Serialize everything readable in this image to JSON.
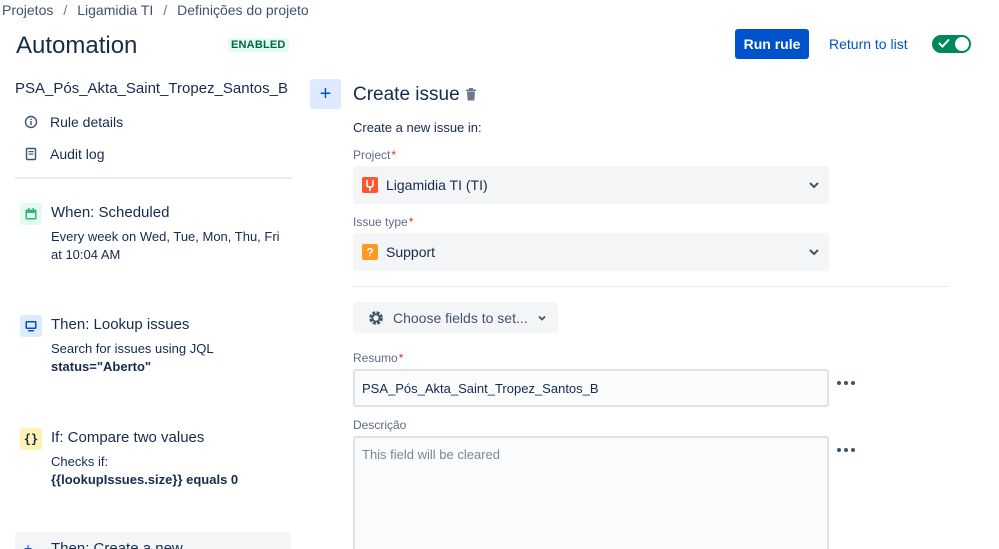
{
  "breadcrumb": [
    "Projetos",
    "Ligamidia TI",
    "Definições do projeto"
  ],
  "header": {
    "title": "Automation",
    "status_badge": "ENABLED",
    "run_label": "Run rule",
    "return_label": "Return to list",
    "toggle_on": true
  },
  "sidebar": {
    "rule_name": "PSA_Pós_Akta_Saint_Tropez_Santos_B",
    "links": [
      {
        "label": "Rule details",
        "icon": "info-icon"
      },
      {
        "label": "Audit log",
        "icon": "document-icon"
      }
    ],
    "steps": [
      {
        "title": "When: Scheduled",
        "line1": "Every week on Wed, Tue, Mon, Thu, Fri",
        "line2": "at 10:04 AM",
        "icon": "calendar-icon",
        "color": "#36b37e"
      },
      {
        "title": "Then: Lookup issues",
        "line1": "Search for issues using JQL",
        "line2": "status=\"Aberto\"",
        "icon": "monitor-icon",
        "color": "#0052cc"
      },
      {
        "title": "If: Compare two values",
        "line1": "Checks if:",
        "line2": "{{lookupIssues.size}} equals 0",
        "icon": "braces-icon",
        "color": "#ffab00"
      }
    ],
    "last_step_title": "Then: Create a new"
  },
  "panel": {
    "title": "Create issue",
    "subtitle": "Create a new issue in:",
    "project_label": "Project",
    "project_value": "Ligamidia TI (TI)",
    "issue_type_label": "Issue type",
    "issue_type_value": "Support",
    "choose_fields_label": "Choose fields to set...",
    "summary_label": "Resumo",
    "summary_value": "PSA_Pós_Akta_Saint_Tropez_Santos_B",
    "description_label": "Descrição",
    "description_placeholder": "This field will be cleared",
    "required_mark": "*"
  },
  "colors": {
    "primary": "#0052cc",
    "success": "#00875a",
    "project_icon": "#ff5630",
    "support_icon": "#ff991f"
  }
}
